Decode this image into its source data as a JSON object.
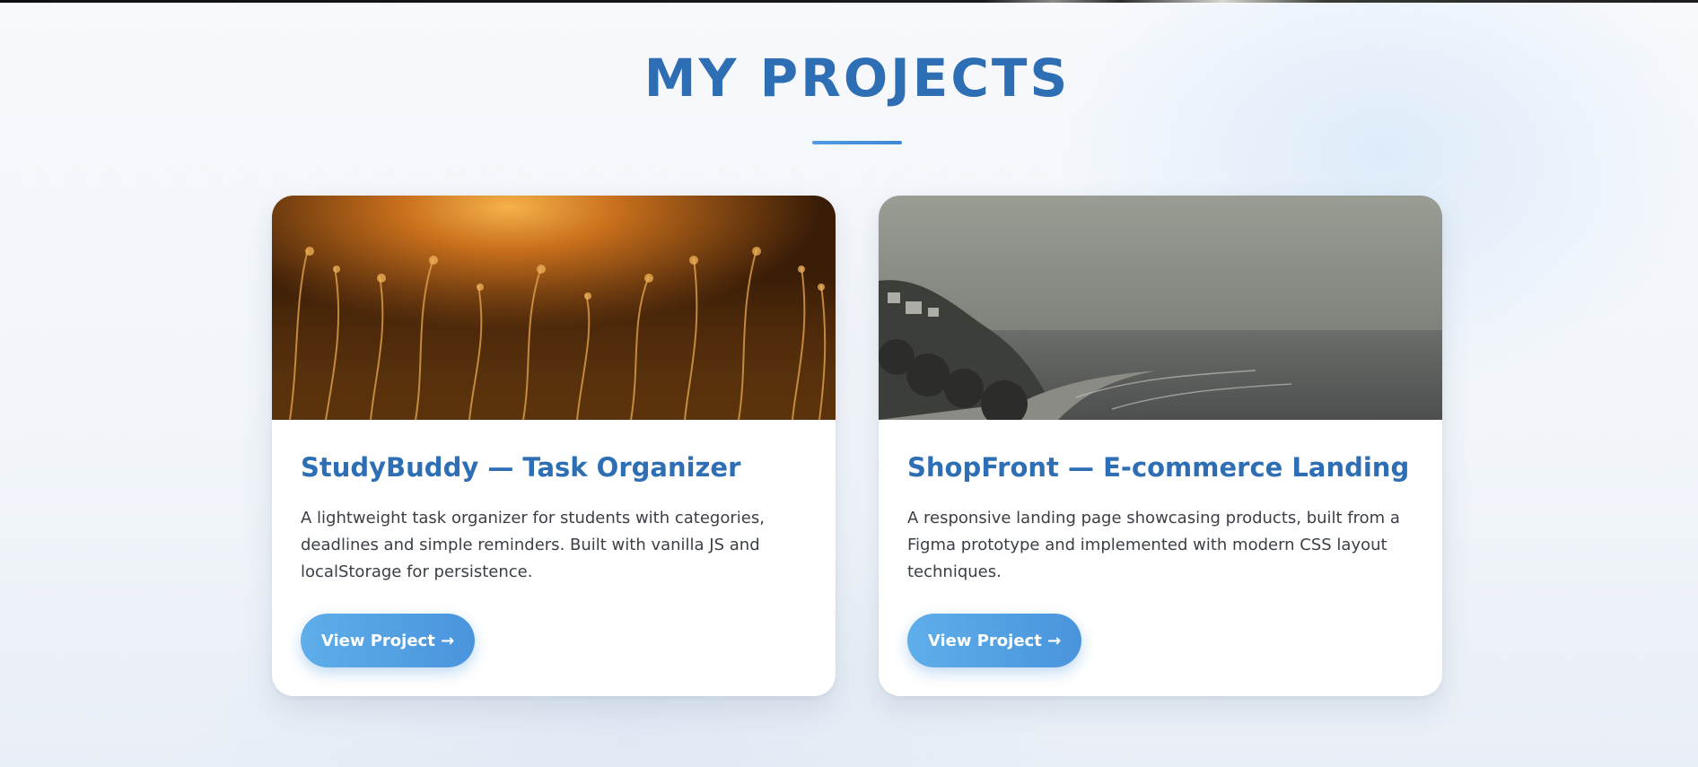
{
  "section": {
    "title": "MY PROJECTS"
  },
  "projects": [
    {
      "title": "StudyBuddy — Task Organizer",
      "description": "A lightweight task organizer for students with categories, deadlines and simple reminders. Built with vanilla JS and localStorage for persistence.",
      "button_label": "View Project →"
    },
    {
      "title": "ShopFront — E-commerce Landing",
      "description": "A responsive landing page showcasing products, built from a Figma prototype and implemented with modern CSS layout techniques.",
      "button_label": "View Project →"
    }
  ],
  "colors": {
    "accent": "#2d6eb4",
    "button": "#4a94dd",
    "background": "#f3f6fa"
  }
}
